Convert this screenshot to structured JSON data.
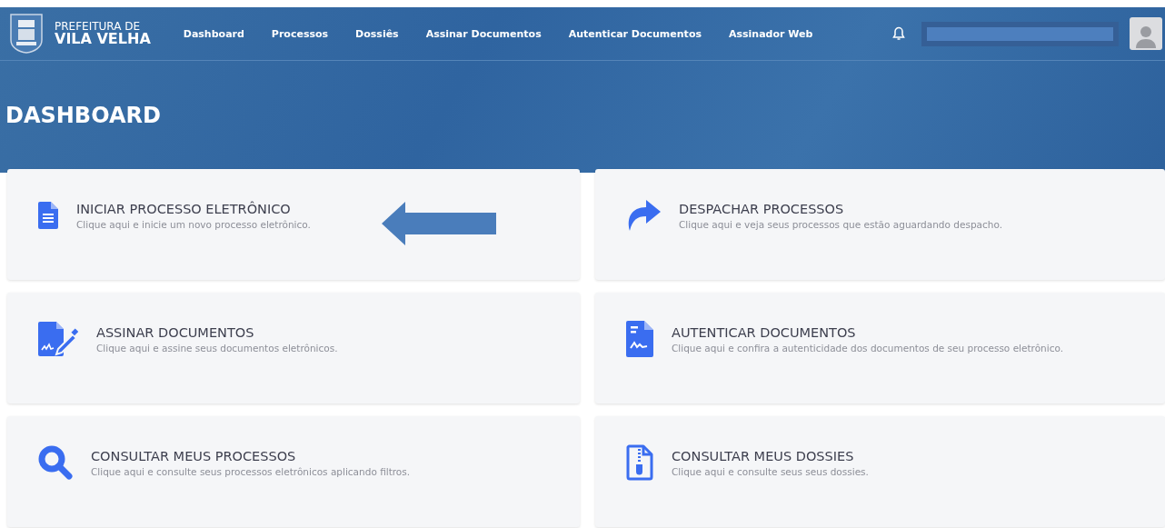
{
  "header": {
    "brand_top": "PREFEITURA DE",
    "brand_bottom": "VILA VELHA",
    "nav": [
      "Dashboard",
      "Processos",
      "Dossiês",
      "Assinar Documentos",
      "Autenticar Documentos",
      "Assinador Web"
    ]
  },
  "page_title": "DASHBOARD",
  "cards": [
    {
      "kind": "document",
      "title": "INICIAR PROCESSO ELETRÔNICO",
      "subtitle": "Clique aqui e inicie um novo processo eletrônico.",
      "pointer_arrow": true
    },
    {
      "kind": "forward",
      "title": "DESPACHAR PROCESSOS",
      "subtitle": "Clique aqui e veja seus processos que estão aguardando despacho.",
      "pointer_arrow": false
    },
    {
      "kind": "sign",
      "title": "ASSINAR DOCUMENTOS",
      "subtitle": "Clique aqui e assine seus documentos eletrônicos.",
      "pointer_arrow": false
    },
    {
      "kind": "authenticate",
      "title": "AUTENTICAR DOCUMENTOS",
      "subtitle": "Clique aqui e confira a autenticidade dos documentos de seu processo eletrônico.",
      "pointer_arrow": false
    },
    {
      "kind": "search",
      "title": "CONSULTAR MEUS PROCESSOS",
      "subtitle": "Clique aqui e consulte seus processos eletrônicos aplicando filtros.",
      "pointer_arrow": false
    },
    {
      "kind": "zip",
      "title": "CONSULTAR MEUS DOSSIES",
      "subtitle": "Clique aqui e consulte seus seus dossies.",
      "pointer_arrow": false
    }
  ]
}
